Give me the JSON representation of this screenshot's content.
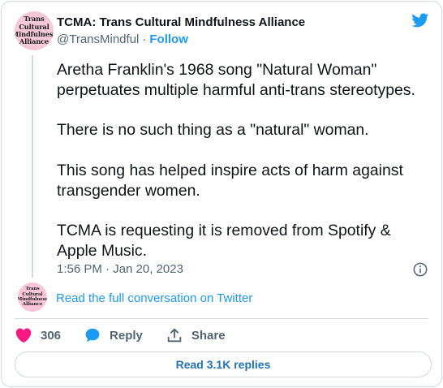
{
  "author": {
    "display_name": "TCMA: Trans Cultural Mindfulness Alliance",
    "handle": "@TransMindful",
    "separator": "·",
    "follow_label": "Follow",
    "avatar_lines": [
      "Trans",
      "Cultural",
      "Mindfulness",
      "Alliance"
    ]
  },
  "tweet": {
    "paragraphs": [
      "Aretha Franklin's 1968 song \"Natural Woman\" perpetuates multiple harmful anti-trans stereotypes.",
      "There is no such thing as a \"natural\" woman.",
      "This song has helped inspire acts of harm against transgender women.",
      "TCMA is requesting it is removed from Spotify & Apple Music."
    ],
    "timestamp": "1:56 PM · Jan 20, 2023"
  },
  "conversation": {
    "link_label": "Read the full conversation on Twitter"
  },
  "actions": {
    "like_count": "306",
    "reply_label": "Reply",
    "share_label": "Share"
  },
  "replies_button": {
    "label": "Read 3.1K replies"
  },
  "colors": {
    "accent": "#1d9bf0",
    "like": "#f91880",
    "muted": "#536471",
    "border": "#cfd9de",
    "avatar_bg": "#f6c8d8"
  },
  "icons": [
    "twitter-bird-icon",
    "info-icon",
    "heart-icon",
    "reply-bubble-icon",
    "share-icon"
  ]
}
